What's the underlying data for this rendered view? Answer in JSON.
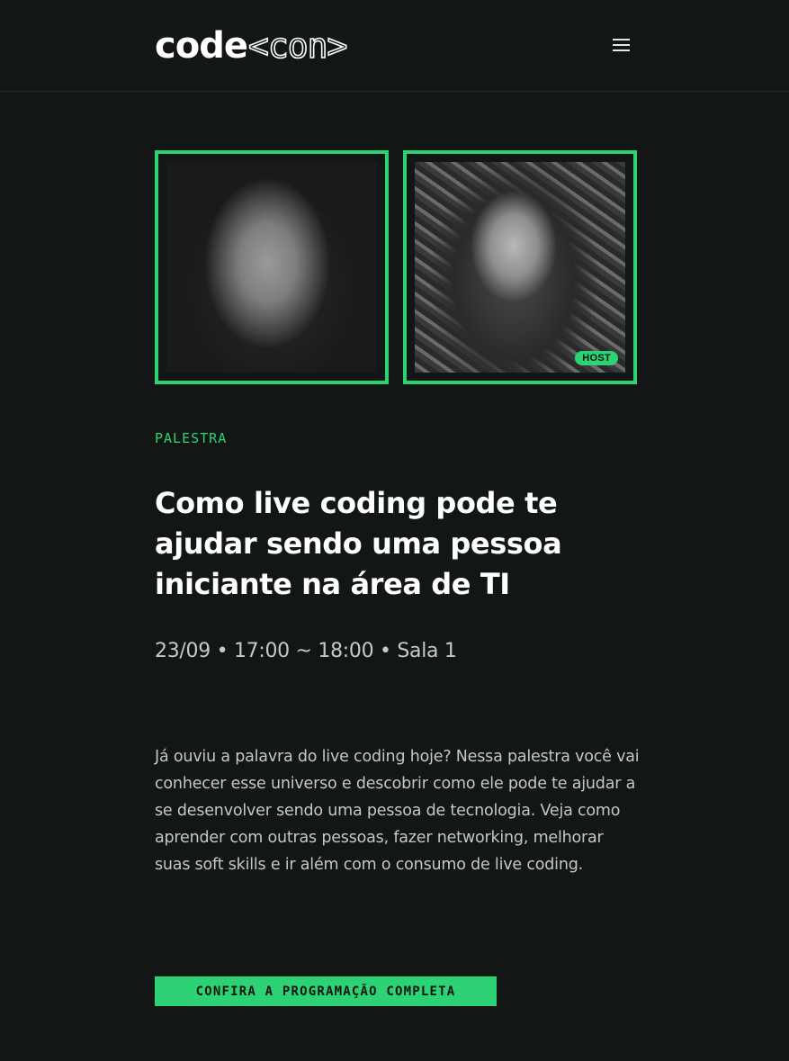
{
  "header": {
    "logo": {
      "code": "code",
      "con": "<con>"
    },
    "menu_icon": "hamburger-menu-icon"
  },
  "speakers": [
    {
      "photo": "speaker-photo-1"
    },
    {
      "photo": "speaker-photo-2",
      "badge": "HOST"
    }
  ],
  "talk": {
    "category": "PALESTRA",
    "title": "Como live coding pode te ajudar sendo uma pessoa iniciante na área de TI",
    "meta": "23/09 • 17:00 ~ 18:00 • Sala 1",
    "description": "Já ouviu a palavra do live coding hoje? Nessa palestra você vai conhecer esse universo e descobrir como ele pode te ajudar a se desenvolver sendo uma pessoa de tecnologia. Veja como aprender com outras pessoas, fazer networking, melhorar suas soft skills e ir além com o consumo de live coding.",
    "cta_label": "CONFIRA A PROGRAMAÇÃO COMPLETA"
  },
  "colors": {
    "background": "#121614",
    "accent": "#2dd274",
    "text": "#ffffff",
    "muted_text": "#c6c6c6"
  }
}
